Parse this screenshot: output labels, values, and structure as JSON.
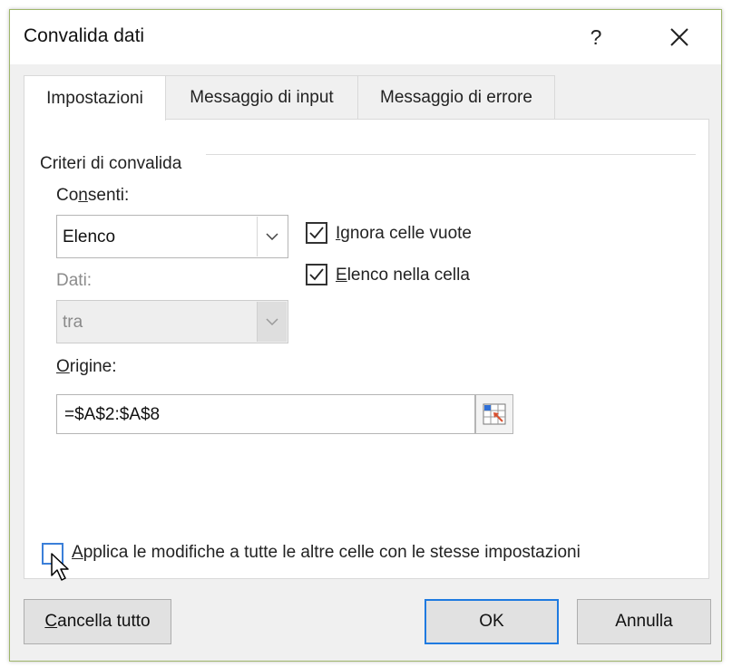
{
  "window": {
    "title": "Convalida dati",
    "help_label": "?"
  },
  "tabs": [
    {
      "label": "Impostazioni",
      "active": true
    },
    {
      "label": "Messaggio di input",
      "active": false
    },
    {
      "label": "Messaggio di errore",
      "active": false
    }
  ],
  "settings": {
    "group_title": "Criteri di convalida",
    "allow": {
      "label_pre": "Co",
      "label_key": "n",
      "label_post": "senti:",
      "value": "Elenco"
    },
    "data": {
      "label": "Dati:",
      "value": "tra",
      "enabled": false
    },
    "ignore_blank": {
      "key": "I",
      "rest": "gnora celle vuote",
      "checked": true
    },
    "in_cell_dropdown": {
      "key": "E",
      "rest": "lenco nella cella",
      "checked": true
    },
    "source": {
      "key": "O",
      "rest": "rigine:",
      "value": "=$A$2:$A$8"
    },
    "apply_all": {
      "key": "A",
      "rest": "pplica le modifiche a tutte le altre celle con le stesse impostazioni",
      "checked": false
    }
  },
  "buttons": {
    "clear_key": "C",
    "clear_rest": "ancella tutto",
    "ok": "OK",
    "cancel": "Annulla"
  },
  "colors": {
    "accent": "#1f7ae0",
    "frame": "#9fb66a",
    "disabled_text": "#8c8c8c"
  },
  "icons": [
    "help-icon",
    "close-icon",
    "chevron-down-icon",
    "checkmark-icon",
    "range-selector-icon",
    "mouse-pointer-icon"
  ]
}
